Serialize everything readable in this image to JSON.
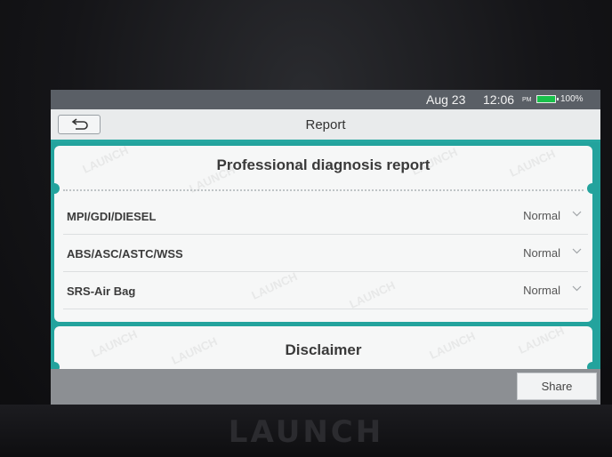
{
  "status_bar": {
    "date": "Aug 23",
    "time": "12:06",
    "ampm": "PM",
    "battery": "100%",
    "battery_icon": "battery-full-icon",
    "battery_color": "#19c04a"
  },
  "header": {
    "back_icon": "back-arrow-icon",
    "title": "Report"
  },
  "report": {
    "title": "Professional diagnosis report",
    "items": [
      {
        "label": "MPI/GDI/DIESEL",
        "status": "Normal"
      },
      {
        "label": "ABS/ASC/ASTC/WSS",
        "status": "Normal"
      },
      {
        "label": "SRS-Air Bag",
        "status": "Normal"
      }
    ]
  },
  "disclaimer": {
    "title": "Disclaimer"
  },
  "footer": {
    "share_label": "Share"
  },
  "device": {
    "brand": "LAUNCH"
  },
  "theme": {
    "accent": "#23a39d"
  }
}
